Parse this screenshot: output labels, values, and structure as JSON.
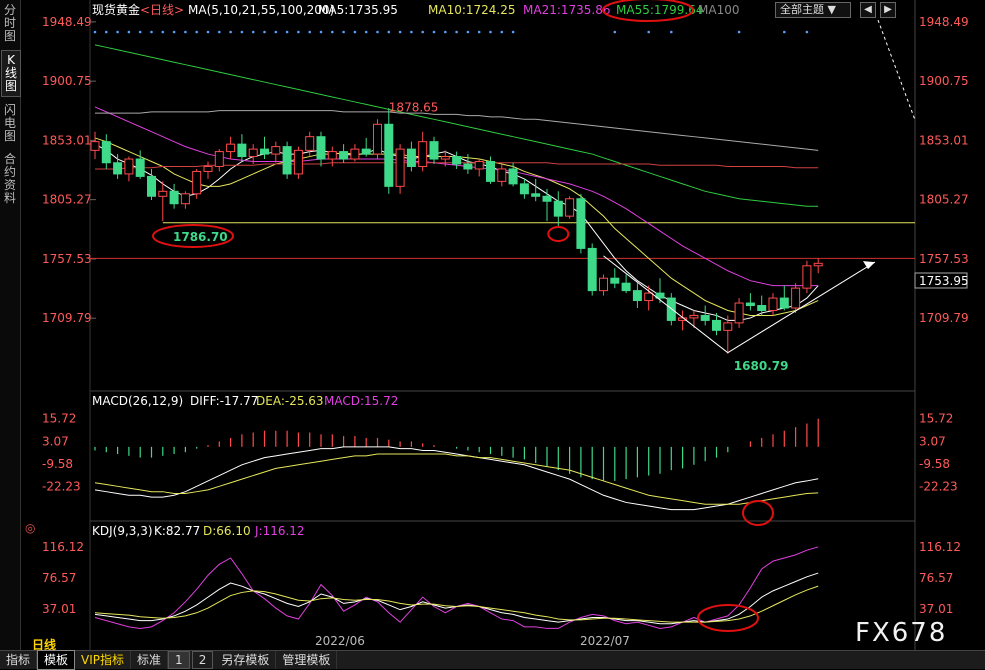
{
  "left_tabs": [
    "分时图",
    "K线图",
    "闪电图",
    "合约资料"
  ],
  "header": {
    "instrument": "现货黄金",
    "period": "<日线>",
    "ma_label": "MA(5,10,21,55,100,200)",
    "ma5": "MA5:1735.95",
    "ma10": "MA10:1724.25",
    "ma21": "MA21:1735.86",
    "ma55": "MA55:1799.64",
    "ma100": "MA100",
    "theme_button": "全部主题",
    "nav_prev": "◀",
    "nav_next": "▶"
  },
  "annotations": {
    "high_label": "1878.65",
    "support_label": "1786.70",
    "low_label": "1680.79",
    "last_price": "1753.95"
  },
  "price_axis": [
    "1948.49",
    "1900.75",
    "1853.01",
    "1805.27",
    "1757.53",
    "1709.79"
  ],
  "macd": {
    "title": "MACD(26,12,9)",
    "diff": "DIFF:-17.77",
    "dea": "DEA:-25.63",
    "macd": "MACD:15.72",
    "axis": [
      "15.72",
      "3.07",
      "-9.58",
      "-22.23"
    ]
  },
  "kdj": {
    "title": "KDJ(9,3,3)",
    "k": "K:82.77",
    "d": "D:66.10",
    "j": "J:116.12",
    "axis": [
      "116.12",
      "76.57",
      "37.01"
    ]
  },
  "date_axis": [
    "2022/06",
    "2022/07"
  ],
  "period_label": "日线",
  "bottom_bar": {
    "items": [
      "指标",
      "模板",
      "VIP指标",
      "标准",
      "1",
      "2",
      "另存模板",
      "管理模板"
    ]
  },
  "watermark": "FX678",
  "colors": {
    "up": "#ff4a4a",
    "down": "#3fd98a",
    "ma5": "#ffffff",
    "ma10": "#e6e65c",
    "ma21": "#e040e0",
    "ma55": "#2ecc40",
    "ma100": "#aaaaaa",
    "ma200": "#d04040"
  },
  "chart_data": {
    "type": "candlestick",
    "title": "现货黄金 <日线>",
    "price_ylim": [
      1670,
      1950
    ],
    "candles": [
      {
        "o": 1845,
        "h": 1860,
        "l": 1838,
        "c": 1852
      },
      {
        "o": 1852,
        "h": 1858,
        "l": 1830,
        "c": 1835
      },
      {
        "o": 1835,
        "h": 1842,
        "l": 1822,
        "c": 1826
      },
      {
        "o": 1826,
        "h": 1840,
        "l": 1820,
        "c": 1838
      },
      {
        "o": 1838,
        "h": 1845,
        "l": 1822,
        "c": 1824
      },
      {
        "o": 1824,
        "h": 1830,
        "l": 1805,
        "c": 1808
      },
      {
        "o": 1808,
        "h": 1820,
        "l": 1788,
        "c": 1812
      },
      {
        "o": 1812,
        "h": 1818,
        "l": 1798,
        "c": 1802
      },
      {
        "o": 1802,
        "h": 1812,
        "l": 1798,
        "c": 1810
      },
      {
        "o": 1810,
        "h": 1830,
        "l": 1806,
        "c": 1828
      },
      {
        "o": 1828,
        "h": 1836,
        "l": 1822,
        "c": 1832
      },
      {
        "o": 1832,
        "h": 1846,
        "l": 1828,
        "c": 1844
      },
      {
        "o": 1844,
        "h": 1856,
        "l": 1838,
        "c": 1850
      },
      {
        "o": 1850,
        "h": 1858,
        "l": 1836,
        "c": 1840
      },
      {
        "o": 1840,
        "h": 1850,
        "l": 1834,
        "c": 1846
      },
      {
        "o": 1846,
        "h": 1856,
        "l": 1838,
        "c": 1842
      },
      {
        "o": 1842,
        "h": 1852,
        "l": 1835,
        "c": 1848
      },
      {
        "o": 1848,
        "h": 1852,
        "l": 1822,
        "c": 1826
      },
      {
        "o": 1826,
        "h": 1848,
        "l": 1822,
        "c": 1845
      },
      {
        "o": 1845,
        "h": 1860,
        "l": 1840,
        "c": 1856
      },
      {
        "o": 1856,
        "h": 1860,
        "l": 1832,
        "c": 1838
      },
      {
        "o": 1838,
        "h": 1848,
        "l": 1832,
        "c": 1844
      },
      {
        "o": 1844,
        "h": 1850,
        "l": 1835,
        "c": 1838
      },
      {
        "o": 1838,
        "h": 1850,
        "l": 1836,
        "c": 1846
      },
      {
        "o": 1846,
        "h": 1855,
        "l": 1840,
        "c": 1842
      },
      {
        "o": 1842,
        "h": 1870,
        "l": 1838,
        "c": 1866
      },
      {
        "o": 1866,
        "h": 1879,
        "l": 1810,
        "c": 1816
      },
      {
        "o": 1816,
        "h": 1850,
        "l": 1810,
        "c": 1846
      },
      {
        "o": 1846,
        "h": 1852,
        "l": 1828,
        "c": 1832
      },
      {
        "o": 1832,
        "h": 1860,
        "l": 1828,
        "c": 1852
      },
      {
        "o": 1852,
        "h": 1856,
        "l": 1834,
        "c": 1838
      },
      {
        "o": 1838,
        "h": 1845,
        "l": 1832,
        "c": 1840
      },
      {
        "o": 1840,
        "h": 1844,
        "l": 1830,
        "c": 1834
      },
      {
        "o": 1834,
        "h": 1842,
        "l": 1826,
        "c": 1830
      },
      {
        "o": 1830,
        "h": 1838,
        "l": 1824,
        "c": 1836
      },
      {
        "o": 1836,
        "h": 1840,
        "l": 1818,
        "c": 1820
      },
      {
        "o": 1820,
        "h": 1834,
        "l": 1816,
        "c": 1830
      },
      {
        "o": 1830,
        "h": 1835,
        "l": 1816,
        "c": 1818
      },
      {
        "o": 1818,
        "h": 1822,
        "l": 1806,
        "c": 1810
      },
      {
        "o": 1810,
        "h": 1822,
        "l": 1804,
        "c": 1808
      },
      {
        "o": 1808,
        "h": 1814,
        "l": 1788,
        "c": 1804
      },
      {
        "o": 1804,
        "h": 1812,
        "l": 1784,
        "c": 1792
      },
      {
        "o": 1792,
        "h": 1808,
        "l": 1790,
        "c": 1806
      },
      {
        "o": 1806,
        "h": 1810,
        "l": 1762,
        "c": 1766
      },
      {
        "o": 1766,
        "h": 1770,
        "l": 1728,
        "c": 1732
      },
      {
        "o": 1732,
        "h": 1745,
        "l": 1728,
        "c": 1742
      },
      {
        "o": 1742,
        "h": 1750,
        "l": 1734,
        "c": 1738
      },
      {
        "o": 1738,
        "h": 1745,
        "l": 1730,
        "c": 1732
      },
      {
        "o": 1732,
        "h": 1738,
        "l": 1718,
        "c": 1724
      },
      {
        "o": 1724,
        "h": 1736,
        "l": 1716,
        "c": 1730
      },
      {
        "o": 1730,
        "h": 1742,
        "l": 1722,
        "c": 1726
      },
      {
        "o": 1726,
        "h": 1730,
        "l": 1704,
        "c": 1708
      },
      {
        "o": 1708,
        "h": 1716,
        "l": 1700,
        "c": 1710
      },
      {
        "o": 1710,
        "h": 1716,
        "l": 1702,
        "c": 1712
      },
      {
        "o": 1712,
        "h": 1720,
        "l": 1704,
        "c": 1708
      },
      {
        "o": 1708,
        "h": 1714,
        "l": 1696,
        "c": 1700
      },
      {
        "o": 1700,
        "h": 1712,
        "l": 1681,
        "c": 1706
      },
      {
        "o": 1706,
        "h": 1726,
        "l": 1702,
        "c": 1722
      },
      {
        "o": 1722,
        "h": 1730,
        "l": 1716,
        "c": 1720
      },
      {
        "o": 1720,
        "h": 1728,
        "l": 1712,
        "c": 1716
      },
      {
        "o": 1716,
        "h": 1730,
        "l": 1712,
        "c": 1726
      },
      {
        "o": 1726,
        "h": 1736,
        "l": 1716,
        "c": 1718
      },
      {
        "o": 1718,
        "h": 1738,
        "l": 1714,
        "c": 1734
      },
      {
        "o": 1734,
        "h": 1756,
        "l": 1730,
        "c": 1752
      },
      {
        "o": 1752,
        "h": 1758,
        "l": 1746,
        "c": 1754
      }
    ],
    "ma_lines": {
      "MA5": [
        1850,
        1845,
        1838,
        1834,
        1830,
        1825,
        1818,
        1812,
        1808,
        1810,
        1815,
        1822,
        1830,
        1836,
        1840,
        1842,
        1844,
        1842,
        1842,
        1844,
        1845,
        1843,
        1842,
        1841,
        1843,
        1846,
        1842,
        1840,
        1838,
        1840,
        1842,
        1844,
        1840,
        1836,
        1834,
        1832,
        1828,
        1826,
        1822,
        1816,
        1810,
        1804,
        1800,
        1794,
        1782,
        1770,
        1758,
        1748,
        1740,
        1734,
        1728,
        1724,
        1720,
        1716,
        1714,
        1712,
        1708,
        1708,
        1710,
        1714,
        1716,
        1718,
        1720,
        1726,
        1736
      ],
      "MA10": [
        1855,
        1852,
        1848,
        1844,
        1840,
        1836,
        1832,
        1826,
        1822,
        1818,
        1816,
        1816,
        1818,
        1822,
        1826,
        1830,
        1834,
        1836,
        1838,
        1840,
        1842,
        1842,
        1843,
        1842,
        1842,
        1842,
        1842,
        1842,
        1840,
        1840,
        1840,
        1840,
        1840,
        1839,
        1838,
        1836,
        1834,
        1832,
        1828,
        1825,
        1822,
        1818,
        1814,
        1808,
        1800,
        1792,
        1782,
        1774,
        1766,
        1758,
        1750,
        1742,
        1736,
        1730,
        1724,
        1720,
        1716,
        1714,
        1712,
        1712,
        1712,
        1714,
        1716,
        1720,
        1724
      ],
      "MA21": [
        1880,
        1876,
        1872,
        1868,
        1864,
        1860,
        1856,
        1852,
        1848,
        1845,
        1842,
        1840,
        1838,
        1837,
        1836,
        1836,
        1836,
        1836,
        1836,
        1837,
        1838,
        1838,
        1838,
        1838,
        1838,
        1838,
        1838,
        1837,
        1836,
        1836,
        1835,
        1834,
        1833,
        1832,
        1831,
        1830,
        1829,
        1828,
        1826,
        1824,
        1822,
        1820,
        1818,
        1815,
        1812,
        1808,
        1803,
        1798,
        1792,
        1786,
        1780,
        1774,
        1768,
        1763,
        1758,
        1753,
        1748,
        1744,
        1740,
        1738,
        1736,
        1736,
        1736,
        1736,
        1736
      ],
      "MA55": [
        1930,
        1928,
        1926,
        1924,
        1922,
        1920,
        1918,
        1916,
        1914,
        1912,
        1910,
        1908,
        1906,
        1904,
        1902,
        1900,
        1898,
        1896,
        1894,
        1892,
        1890,
        1888,
        1886,
        1884,
        1882,
        1880,
        1878,
        1876,
        1874,
        1872,
        1870,
        1868,
        1866,
        1864,
        1862,
        1860,
        1858,
        1856,
        1854,
        1852,
        1850,
        1848,
        1846,
        1844,
        1842,
        1839,
        1836,
        1833,
        1830,
        1827,
        1824,
        1821,
        1818,
        1815,
        1812,
        1810,
        1808,
        1806,
        1805,
        1804,
        1803,
        1802,
        1801,
        1800,
        1800
      ],
      "MA100": [
        1875,
        1875,
        1875,
        1875,
        1875,
        1876,
        1876,
        1876,
        1876,
        1876,
        1876,
        1877,
        1877,
        1877,
        1877,
        1877,
        1877,
        1877,
        1877,
        1877,
        1877,
        1877,
        1876,
        1876,
        1876,
        1876,
        1876,
        1875,
        1875,
        1875,
        1874,
        1874,
        1874,
        1873,
        1873,
        1872,
        1872,
        1871,
        1870,
        1870,
        1869,
        1868,
        1867,
        1866,
        1865,
        1864,
        1863,
        1862,
        1861,
        1860,
        1859,
        1858,
        1857,
        1856,
        1855,
        1854,
        1853,
        1852,
        1851,
        1850,
        1849,
        1848,
        1847,
        1846,
        1845
      ],
      "MA200": [
        1830,
        1830,
        1830,
        1831,
        1831,
        1831,
        1832,
        1832,
        1832,
        1832,
        1833,
        1833,
        1833,
        1833,
        1833,
        1834,
        1834,
        1834,
        1834,
        1834,
        1834,
        1835,
        1835,
        1835,
        1835,
        1835,
        1835,
        1835,
        1835,
        1835,
        1835,
        1835,
        1835,
        1835,
        1835,
        1835,
        1835,
        1835,
        1835,
        1835,
        1835,
        1834,
        1834,
        1834,
        1834,
        1834,
        1834,
        1834,
        1834,
        1834,
        1833,
        1833,
        1833,
        1833,
        1833,
        1833,
        1832,
        1832,
        1832,
        1832,
        1832,
        1832,
        1831,
        1831,
        1831
      ]
    },
    "price_levels": {
      "support": 1786.7,
      "last": 1753.95,
      "high": 1878.65,
      "low": 1680.79
    },
    "macd_ylim": [
      -38,
      20
    ],
    "macd_hist": [
      -2,
      -3,
      -4,
      -5,
      -6,
      -6,
      -5,
      -4,
      -3,
      -1,
      1,
      3,
      5,
      7,
      8,
      9,
      9,
      9,
      8,
      8,
      7,
      7,
      6,
      6,
      5,
      5,
      4,
      3,
      3,
      2,
      1,
      0,
      -1,
      -2,
      -3,
      -4,
      -5,
      -6,
      -7,
      -9,
      -11,
      -13,
      -15,
      -17,
      -18,
      -19,
      -19,
      -18,
      -17,
      -16,
      -15,
      -13,
      -12,
      -10,
      -8,
      -6,
      -3,
      0,
      3,
      5,
      7,
      9,
      11,
      13,
      15.72
    ],
    "macd_diff": [
      -24,
      -25,
      -26,
      -27,
      -27,
      -28,
      -28,
      -27,
      -25,
      -22,
      -19,
      -16,
      -13,
      -10,
      -8,
      -6,
      -5,
      -4,
      -3,
      -2,
      -1,
      -1,
      0,
      0,
      0,
      0,
      0,
      -1,
      -1,
      -2,
      -2,
      -3,
      -4,
      -5,
      -6,
      -7,
      -8,
      -9,
      -10,
      -12,
      -14,
      -16,
      -18,
      -21,
      -24,
      -27,
      -29,
      -31,
      -32,
      -33,
      -34,
      -35,
      -35,
      -35,
      -34,
      -33,
      -32,
      -30,
      -28,
      -26,
      -24,
      -22,
      -20,
      -19,
      -17.77
    ],
    "macd_dea": [
      -20,
      -21,
      -22,
      -23,
      -24,
      -25,
      -25,
      -26,
      -26,
      -25,
      -24,
      -22,
      -20,
      -18,
      -16,
      -14,
      -12,
      -11,
      -10,
      -9,
      -8,
      -7,
      -6,
      -5,
      -5,
      -4,
      -4,
      -4,
      -4,
      -4,
      -4,
      -4,
      -5,
      -5,
      -6,
      -6,
      -7,
      -8,
      -9,
      -10,
      -11,
      -12,
      -13,
      -15,
      -17,
      -19,
      -21,
      -23,
      -25,
      -27,
      -28,
      -29,
      -30,
      -31,
      -32,
      -32,
      -32,
      -32,
      -31,
      -30,
      -29,
      -28,
      -27,
      -26,
      -25.63
    ],
    "kdj_ylim": [
      10,
      125
    ],
    "kdj_k": [
      30,
      28,
      26,
      24,
      22,
      22,
      24,
      28,
      34,
      42,
      52,
      62,
      70,
      66,
      60,
      56,
      50,
      44,
      40,
      46,
      56,
      52,
      44,
      46,
      50,
      48,
      42,
      36,
      40,
      46,
      42,
      38,
      40,
      42,
      40,
      36,
      32,
      30,
      26,
      24,
      22,
      20,
      22,
      24,
      26,
      26,
      24,
      22,
      22,
      20,
      18,
      18,
      20,
      22,
      20,
      22,
      24,
      30,
      40,
      52,
      60,
      66,
      72,
      78,
      82.77
    ],
    "kdj_d": [
      32,
      31,
      30,
      29,
      27,
      26,
      25,
      26,
      28,
      32,
      38,
      46,
      54,
      58,
      60,
      59,
      56,
      52,
      48,
      47,
      50,
      51,
      49,
      48,
      49,
      49,
      47,
      44,
      42,
      43,
      43,
      41,
      40,
      41,
      40,
      38,
      36,
      34,
      32,
      29,
      27,
      24,
      23,
      23,
      24,
      25,
      25,
      24,
      23,
      22,
      21,
      20,
      20,
      20,
      20,
      21,
      22,
      24,
      28,
      34,
      41,
      48,
      55,
      61,
      66.1
    ],
    "kdj_j": [
      26,
      22,
      18,
      14,
      12,
      14,
      22,
      32,
      46,
      62,
      80,
      94,
      102,
      82,
      60,
      50,
      38,
      28,
      24,
      44,
      68,
      54,
      34,
      42,
      52,
      46,
      32,
      20,
      36,
      52,
      40,
      32,
      40,
      44,
      40,
      32,
      24,
      22,
      14,
      14,
      12,
      12,
      20,
      26,
      30,
      28,
      22,
      18,
      20,
      16,
      12,
      14,
      20,
      26,
      20,
      24,
      28,
      42,
      64,
      88,
      98,
      102,
      106,
      112,
      116.12
    ]
  }
}
